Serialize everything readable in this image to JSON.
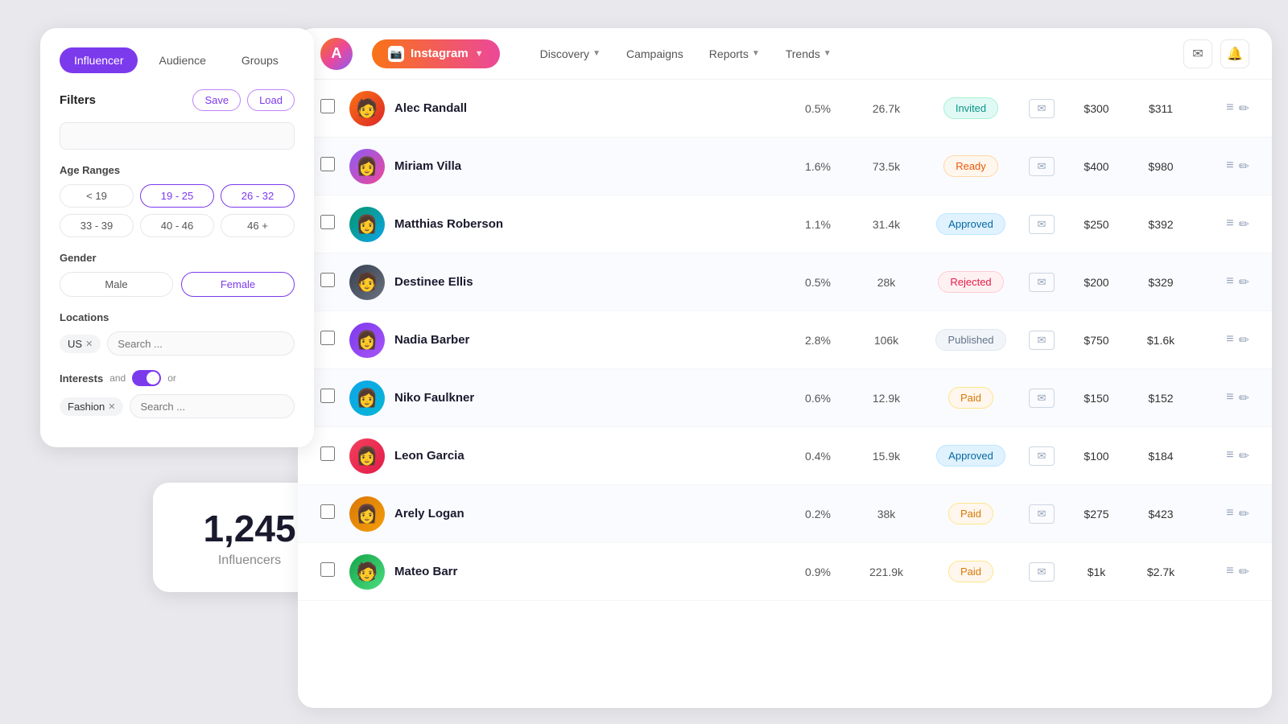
{
  "app": {
    "logo": "A",
    "platform": "Instagram",
    "nav": {
      "items": [
        {
          "label": "Discovery",
          "hasChevron": true
        },
        {
          "label": "Campaigns"
        },
        {
          "label": "Reports",
          "hasChevron": true
        },
        {
          "label": "Trends",
          "hasChevron": true
        }
      ]
    }
  },
  "filter_panel": {
    "tabs": [
      {
        "label": "Influencer",
        "active": true
      },
      {
        "label": "Audience",
        "active": false
      },
      {
        "label": "Groups",
        "active": false
      }
    ],
    "filters_title": "Filters",
    "save_label": "Save",
    "load_label": "Load",
    "search_placeholder": "",
    "age_ranges": {
      "label": "Age Ranges",
      "options": [
        {
          "label": "< 19",
          "active": false
        },
        {
          "label": "19 - 25",
          "active": true
        },
        {
          "label": "26 - 32",
          "active": true
        },
        {
          "label": "33 - 39",
          "active": false
        },
        {
          "label": "40 - 46",
          "active": false
        },
        {
          "label": "46 +",
          "active": false
        }
      ]
    },
    "gender": {
      "label": "Gender",
      "options": [
        {
          "label": "Male",
          "active": false
        },
        {
          "label": "Female",
          "active": true
        }
      ]
    },
    "locations": {
      "label": "Locations",
      "tags": [
        "US"
      ],
      "search_placeholder": "Search ..."
    },
    "interests": {
      "label": "Interests",
      "and_label": "and",
      "or_label": "or",
      "toggle_on": true,
      "tags": [
        "Fashion"
      ],
      "search_placeholder": "Search ..."
    }
  },
  "count_card": {
    "count": "1,245",
    "label": "Influencers"
  },
  "table": {
    "rows": [
      {
        "name": "Alec Randall",
        "rate": "0.5%",
        "followers": "26.7k",
        "status": "Invited",
        "status_class": "invited",
        "price1": "$300",
        "price2": "$311",
        "avatar_class": "av1",
        "avatar_emoji": "🧑"
      },
      {
        "name": "Miriam Villa",
        "rate": "1.6%",
        "followers": "73.5k",
        "status": "Ready",
        "status_class": "ready",
        "price1": "$400",
        "price2": "$980",
        "avatar_class": "av2",
        "avatar_emoji": "👩"
      },
      {
        "name": "Matthias Roberson",
        "rate": "1.1%",
        "followers": "31.4k",
        "status": "Approved",
        "status_class": "approved",
        "price1": "$250",
        "price2": "$392",
        "avatar_class": "av3",
        "avatar_emoji": "👩"
      },
      {
        "name": "Destinee Ellis",
        "rate": "0.5%",
        "followers": "28k",
        "status": "Rejected",
        "status_class": "rejected",
        "price1": "$200",
        "price2": "$329",
        "avatar_class": "av4",
        "avatar_emoji": "🧑"
      },
      {
        "name": "Nadia Barber",
        "rate": "2.8%",
        "followers": "106k",
        "status": "Published",
        "status_class": "published",
        "price1": "$750",
        "price2": "$1.6k",
        "avatar_class": "av5",
        "avatar_emoji": "👩"
      },
      {
        "name": "Niko Faulkner",
        "rate": "0.6%",
        "followers": "12.9k",
        "status": "Paid",
        "status_class": "paid",
        "price1": "$150",
        "price2": "$152",
        "avatar_class": "av6",
        "avatar_emoji": "👩"
      },
      {
        "name": "Leon Garcia",
        "rate": "0.4%",
        "followers": "15.9k",
        "status": "Approved",
        "status_class": "approved",
        "price1": "$100",
        "price2": "$184",
        "avatar_class": "av7",
        "avatar_emoji": "👩"
      },
      {
        "name": "Arely Logan",
        "rate": "0.2%",
        "followers": "38k",
        "status": "Paid",
        "status_class": "paid",
        "price1": "$275",
        "price2": "$423",
        "avatar_class": "av8",
        "avatar_emoji": "👩"
      },
      {
        "name": "Mateo Barr",
        "rate": "0.9%",
        "followers": "221.9k",
        "status": "Paid",
        "status_class": "paid",
        "price1": "$1k",
        "price2": "$2.7k",
        "avatar_class": "av9",
        "avatar_emoji": "🧑"
      }
    ]
  }
}
